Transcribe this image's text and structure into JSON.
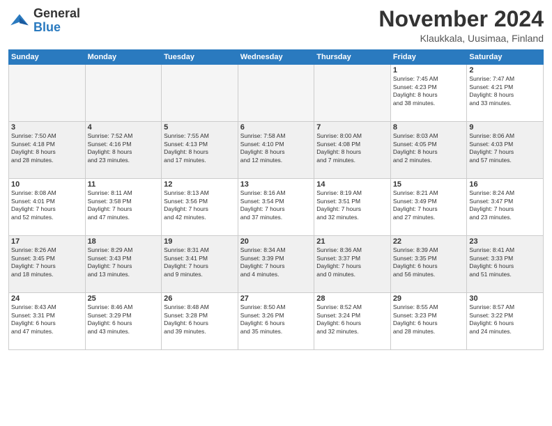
{
  "logo": {
    "text_general": "General",
    "text_blue": "Blue"
  },
  "title": "November 2024",
  "location": "Klaukkala, Uusimaa, Finland",
  "days_of_week": [
    "Sunday",
    "Monday",
    "Tuesday",
    "Wednesday",
    "Thursday",
    "Friday",
    "Saturday"
  ],
  "weeks": [
    [
      {
        "day": "",
        "info": "",
        "empty": true
      },
      {
        "day": "",
        "info": "",
        "empty": true
      },
      {
        "day": "",
        "info": "",
        "empty": true
      },
      {
        "day": "",
        "info": "",
        "empty": true
      },
      {
        "day": "",
        "info": "",
        "empty": true
      },
      {
        "day": "1",
        "info": "Sunrise: 7:45 AM\nSunset: 4:23 PM\nDaylight: 8 hours\nand 38 minutes."
      },
      {
        "day": "2",
        "info": "Sunrise: 7:47 AM\nSunset: 4:21 PM\nDaylight: 8 hours\nand 33 minutes."
      }
    ],
    [
      {
        "day": "3",
        "info": "Sunrise: 7:50 AM\nSunset: 4:18 PM\nDaylight: 8 hours\nand 28 minutes."
      },
      {
        "day": "4",
        "info": "Sunrise: 7:52 AM\nSunset: 4:16 PM\nDaylight: 8 hours\nand 23 minutes."
      },
      {
        "day": "5",
        "info": "Sunrise: 7:55 AM\nSunset: 4:13 PM\nDaylight: 8 hours\nand 17 minutes."
      },
      {
        "day": "6",
        "info": "Sunrise: 7:58 AM\nSunset: 4:10 PM\nDaylight: 8 hours\nand 12 minutes."
      },
      {
        "day": "7",
        "info": "Sunrise: 8:00 AM\nSunset: 4:08 PM\nDaylight: 8 hours\nand 7 minutes."
      },
      {
        "day": "8",
        "info": "Sunrise: 8:03 AM\nSunset: 4:05 PM\nDaylight: 8 hours\nand 2 minutes."
      },
      {
        "day": "9",
        "info": "Sunrise: 8:06 AM\nSunset: 4:03 PM\nDaylight: 7 hours\nand 57 minutes."
      }
    ],
    [
      {
        "day": "10",
        "info": "Sunrise: 8:08 AM\nSunset: 4:01 PM\nDaylight: 7 hours\nand 52 minutes."
      },
      {
        "day": "11",
        "info": "Sunrise: 8:11 AM\nSunset: 3:58 PM\nDaylight: 7 hours\nand 47 minutes."
      },
      {
        "day": "12",
        "info": "Sunrise: 8:13 AM\nSunset: 3:56 PM\nDaylight: 7 hours\nand 42 minutes."
      },
      {
        "day": "13",
        "info": "Sunrise: 8:16 AM\nSunset: 3:54 PM\nDaylight: 7 hours\nand 37 minutes."
      },
      {
        "day": "14",
        "info": "Sunrise: 8:19 AM\nSunset: 3:51 PM\nDaylight: 7 hours\nand 32 minutes."
      },
      {
        "day": "15",
        "info": "Sunrise: 8:21 AM\nSunset: 3:49 PM\nDaylight: 7 hours\nand 27 minutes."
      },
      {
        "day": "16",
        "info": "Sunrise: 8:24 AM\nSunset: 3:47 PM\nDaylight: 7 hours\nand 23 minutes."
      }
    ],
    [
      {
        "day": "17",
        "info": "Sunrise: 8:26 AM\nSunset: 3:45 PM\nDaylight: 7 hours\nand 18 minutes."
      },
      {
        "day": "18",
        "info": "Sunrise: 8:29 AM\nSunset: 3:43 PM\nDaylight: 7 hours\nand 13 minutes."
      },
      {
        "day": "19",
        "info": "Sunrise: 8:31 AM\nSunset: 3:41 PM\nDaylight: 7 hours\nand 9 minutes."
      },
      {
        "day": "20",
        "info": "Sunrise: 8:34 AM\nSunset: 3:39 PM\nDaylight: 7 hours\nand 4 minutes."
      },
      {
        "day": "21",
        "info": "Sunrise: 8:36 AM\nSunset: 3:37 PM\nDaylight: 7 hours\nand 0 minutes."
      },
      {
        "day": "22",
        "info": "Sunrise: 8:39 AM\nSunset: 3:35 PM\nDaylight: 6 hours\nand 56 minutes."
      },
      {
        "day": "23",
        "info": "Sunrise: 8:41 AM\nSunset: 3:33 PM\nDaylight: 6 hours\nand 51 minutes."
      }
    ],
    [
      {
        "day": "24",
        "info": "Sunrise: 8:43 AM\nSunset: 3:31 PM\nDaylight: 6 hours\nand 47 minutes."
      },
      {
        "day": "25",
        "info": "Sunrise: 8:46 AM\nSunset: 3:29 PM\nDaylight: 6 hours\nand 43 minutes."
      },
      {
        "day": "26",
        "info": "Sunrise: 8:48 AM\nSunset: 3:28 PM\nDaylight: 6 hours\nand 39 minutes."
      },
      {
        "day": "27",
        "info": "Sunrise: 8:50 AM\nSunset: 3:26 PM\nDaylight: 6 hours\nand 35 minutes."
      },
      {
        "day": "28",
        "info": "Sunrise: 8:52 AM\nSunset: 3:24 PM\nDaylight: 6 hours\nand 32 minutes."
      },
      {
        "day": "29",
        "info": "Sunrise: 8:55 AM\nSunset: 3:23 PM\nDaylight: 6 hours\nand 28 minutes."
      },
      {
        "day": "30",
        "info": "Sunrise: 8:57 AM\nSunset: 3:22 PM\nDaylight: 6 hours\nand 24 minutes."
      }
    ]
  ]
}
